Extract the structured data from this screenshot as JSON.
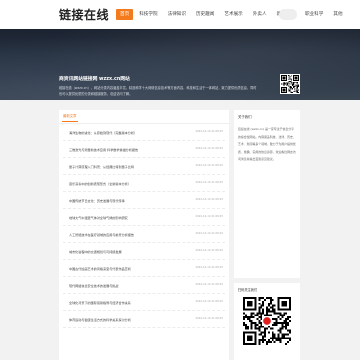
{
  "site": {
    "logo": "链接在线"
  },
  "nav": {
    "items": [
      {
        "label": "首页",
        "active": true
      },
      {
        "label": "科技学院",
        "active": false
      },
      {
        "label": "法律知识",
        "active": false
      },
      {
        "label": "历史趣闻",
        "active": false
      },
      {
        "label": "艺术展示",
        "active": false
      },
      {
        "label": "外卖人",
        "active": false
      },
      {
        "label": "新闻事件",
        "active": false
      },
      {
        "label": "职业科学",
        "active": false
      },
      {
        "label": "其他",
        "active": false
      }
    ]
  },
  "banner": {
    "title": "商资讯网站链接网 wzzx.cn网站",
    "description": "链接在线（wzzx.cn），网站分类内容涵盖丰富，精选科学十大网络信息技术等方面内容，科技和生活于一体网站，致力提供优质信息，同时也可以提供优质的分类和链接服务，欢迎访问了解。"
  },
  "colors": {
    "accent": "#f37b1d",
    "banner_dark": "#1b2230"
  },
  "main": {
    "tab_label": "最新文章",
    "articles": [
      {
        "title": "海洋生物的进化：从原始到现代（完整版本分析）",
        "date": "2024-10-10 21:08:45"
      },
      {
        "title": "三维激光与测量新技术应用 科学数学素描分析报告",
        "date": "2024-10-10 21:08:45"
      },
      {
        "title": "量子计算原理入门科普：从经典比特到量子比特",
        "date": "2024-10-10 21:08:45"
      },
      {
        "title": "音乐演奏中的创新表现形式（全新版本分析）",
        "date": "2024-10-10 21:08:45"
      },
      {
        "title": "中国传统节日文化：历史发展与现代传承",
        "date": "2024-10-10 21:08:45"
      },
      {
        "title": "地球大气中温室气体对全球气候的影响研究",
        "date": "2024-10-10 21:08:45"
      },
      {
        "title": "人工智能技术在医疗领域的应用与前景分析报告",
        "date": "2024-10-10 21:08:45"
      },
      {
        "title": "城市化进程中的交通规划与可持续发展",
        "date": "2024-10-10 21:08:45"
      },
      {
        "title": "中国古代绘画艺术的风格演变与代表作品赏析",
        "date": "2024-10-10 21:08:45"
      },
      {
        "title": "现代网络信息安全技术的发展与挑战",
        "date": "2024-10-10 21:08:45"
      },
      {
        "title": "全球化背景下的国际贸易格局与经济合作关系",
        "date": "2024-10-10 21:08:45"
      },
      {
        "title": "体育运动与健康生活方式的科学关系探讨分析",
        "date": "2024-10-10 21:08:45"
      }
    ]
  },
  "sidebar": {
    "about_title": "关于我们",
    "about_text": "链接在线 (wzzx.cn) 是一家专注于信息分享的综合性网站，内容涵盖科技、法律、历史、艺术、新闻等多个领域，致力于为用户提供优质、准确、实用的信息资源，欢迎各位网友访问浏览并提出宝贵意见建议。",
    "qr_title": "扫码关注我们"
  }
}
